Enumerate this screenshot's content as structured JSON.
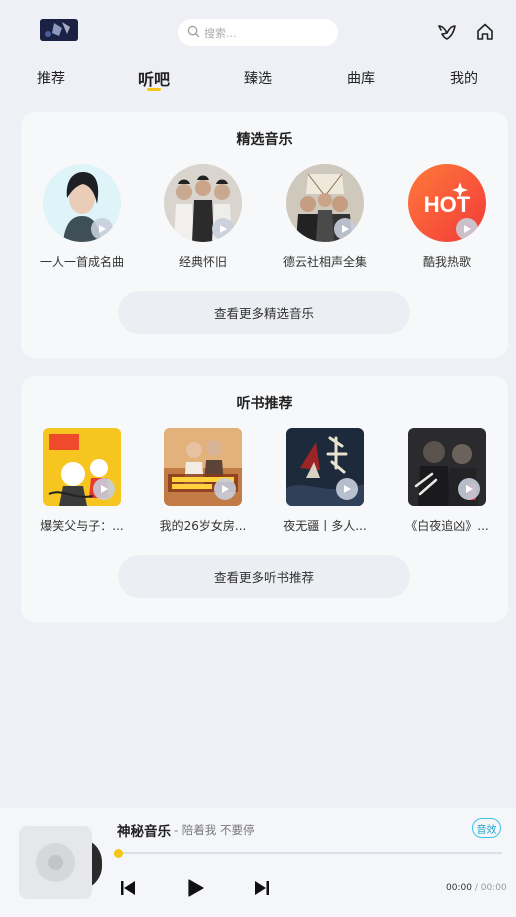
{
  "search": {
    "placeholder": "搜索..."
  },
  "tabs": [
    {
      "label": "推荐"
    },
    {
      "label": "听吧"
    },
    {
      "label": "臻选"
    },
    {
      "label": "曲库"
    },
    {
      "label": "我的"
    }
  ],
  "colors": {
    "accent": "#f5c518",
    "quality": "#1aa6cf"
  },
  "music_section": {
    "title": "精选音乐",
    "items": [
      {
        "label": "一人一首成名曲"
      },
      {
        "label": "经典怀旧"
      },
      {
        "label": "德云社相声全集"
      },
      {
        "label": "酷我热歌",
        "badge_text": "HOT"
      }
    ],
    "more": "查看更多精选音乐"
  },
  "book_section": {
    "title": "听书推荐",
    "items": [
      {
        "label": "爆笑父与子：..."
      },
      {
        "label": "我的26岁女房..."
      },
      {
        "label": "夜无疆丨多人..."
      },
      {
        "label": "《白夜追凶》..."
      }
    ],
    "more": "查看更多听书推荐"
  },
  "player": {
    "title": "神秘音乐",
    "subtitle": "- 陪着我 不要停",
    "quality": "音效",
    "current_time": "00:00",
    "separator": "/",
    "total_time": "00:00",
    "progress": 0
  }
}
